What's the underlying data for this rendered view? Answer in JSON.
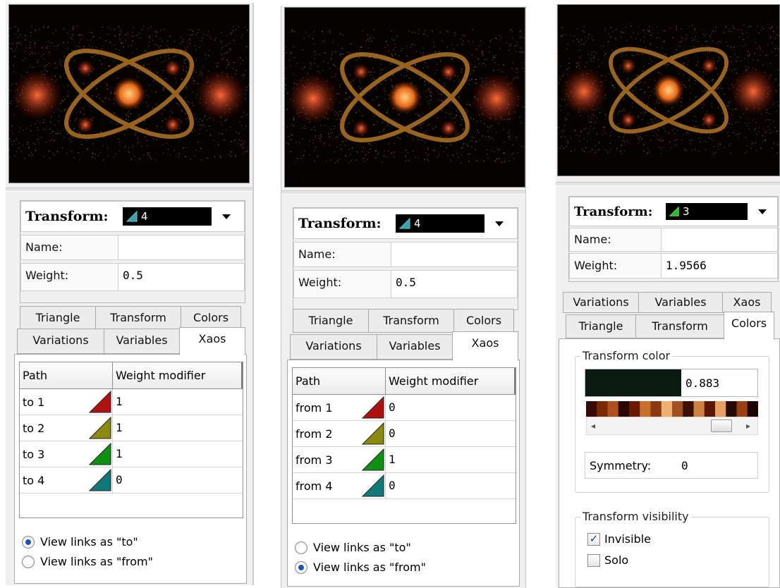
{
  "panels": [
    {
      "transform": {
        "label": "Transform:",
        "value": "4",
        "color": "#2a6a6a"
      },
      "name": {
        "label": "Name:",
        "value": ""
      },
      "weight": {
        "label": "Weight:",
        "value": "0.5"
      },
      "tabs_row1": [
        "Triangle",
        "Transform",
        "Colors"
      ],
      "tabs_row2": [
        "Variations",
        "Variables",
        "Xaos"
      ],
      "active_tab": "Xaos",
      "xaos": {
        "headers": [
          "Path",
          "Weight modifier"
        ],
        "rows": [
          {
            "path": "to 1",
            "value": "1",
            "color": "#b01010"
          },
          {
            "path": "to 2",
            "value": "1",
            "color": "#8a8a10"
          },
          {
            "path": "to 3",
            "value": "1",
            "color": "#109010"
          },
          {
            "path": "to 4",
            "value": "0",
            "color": "#107878"
          }
        ]
      },
      "radios": [
        {
          "label": "View links as \"to\"",
          "checked": true
        },
        {
          "label": "View links as \"from\"",
          "checked": false
        }
      ]
    },
    {
      "transform": {
        "label": "Transform:",
        "value": "4",
        "color": "#2a6a6a"
      },
      "name": {
        "label": "Name:",
        "value": ""
      },
      "weight": {
        "label": "Weight:",
        "value": "0.5"
      },
      "tabs_row1": [
        "Triangle",
        "Transform",
        "Colors"
      ],
      "tabs_row2": [
        "Variations",
        "Variables",
        "Xaos"
      ],
      "active_tab": "Xaos",
      "xaos": {
        "headers": [
          "Path",
          "Weight modifier"
        ],
        "rows": [
          {
            "path": "from 1",
            "value": "0",
            "color": "#b01010"
          },
          {
            "path": "from 2",
            "value": "0",
            "color": "#8a8a10"
          },
          {
            "path": "from 3",
            "value": "1",
            "color": "#109010"
          },
          {
            "path": "from 4",
            "value": "0",
            "color": "#107878"
          }
        ]
      },
      "radios": [
        {
          "label": "View links as \"to\"",
          "checked": false
        },
        {
          "label": "View links as \"from\"",
          "checked": true
        }
      ]
    },
    {
      "transform": {
        "label": "Transform:",
        "value": "3",
        "color": "#1a8a1a"
      },
      "name": {
        "label": "Name:",
        "value": ""
      },
      "weight": {
        "label": "Weight:",
        "value": "1.9566"
      },
      "tabs_row1": [
        "Variations",
        "Variables",
        "Xaos"
      ],
      "tabs_row2": [
        "Triangle",
        "Transform",
        "Colors"
      ],
      "active_tab": "Colors",
      "colors": {
        "group_title": "Transform color",
        "color_value": "0.883",
        "swatch": "#0a1a12",
        "symmetry_label": "Symmetry:",
        "symmetry_value": "0",
        "visibility_title": "Transform visibility",
        "invisible_label": "Invisible",
        "invisible_checked": true,
        "solo_label": "Solo",
        "solo_checked": false
      }
    }
  ]
}
